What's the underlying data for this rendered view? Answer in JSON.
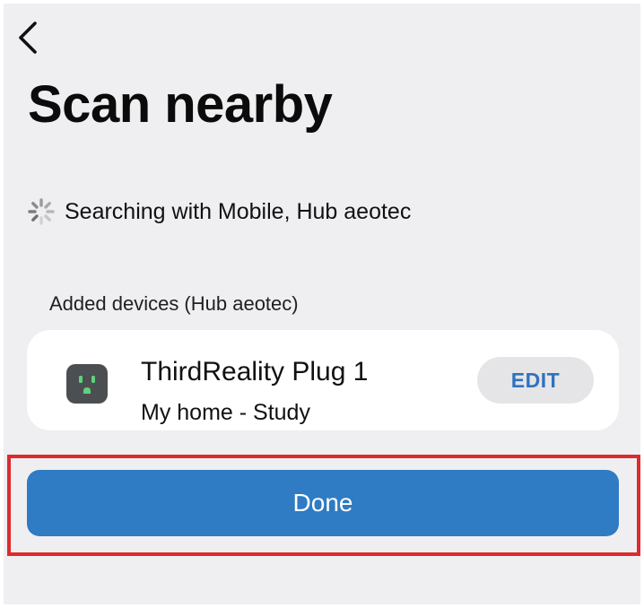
{
  "header": {
    "back_icon": "chevron-left-icon",
    "title": "Scan nearby"
  },
  "status": {
    "spinner_icon": "loading-spinner-icon",
    "text": "Searching with Mobile, Hub aeotec"
  },
  "added_devices": {
    "section_label": "Added devices (Hub aeotec)",
    "items": [
      {
        "icon": "smart-plug-icon",
        "icon_color": "#4c4f52",
        "icon_accent": "#5fd27a",
        "name": "ThirdReality Plug 1",
        "location": "My home - Study",
        "edit_label": "EDIT"
      }
    ]
  },
  "footer": {
    "done_label": "Done"
  },
  "colors": {
    "background": "#efeff1",
    "card": "#ffffff",
    "accent_blue": "#2f7bc4",
    "edit_text": "#2f72c0",
    "highlight": "#dc2a2f"
  }
}
